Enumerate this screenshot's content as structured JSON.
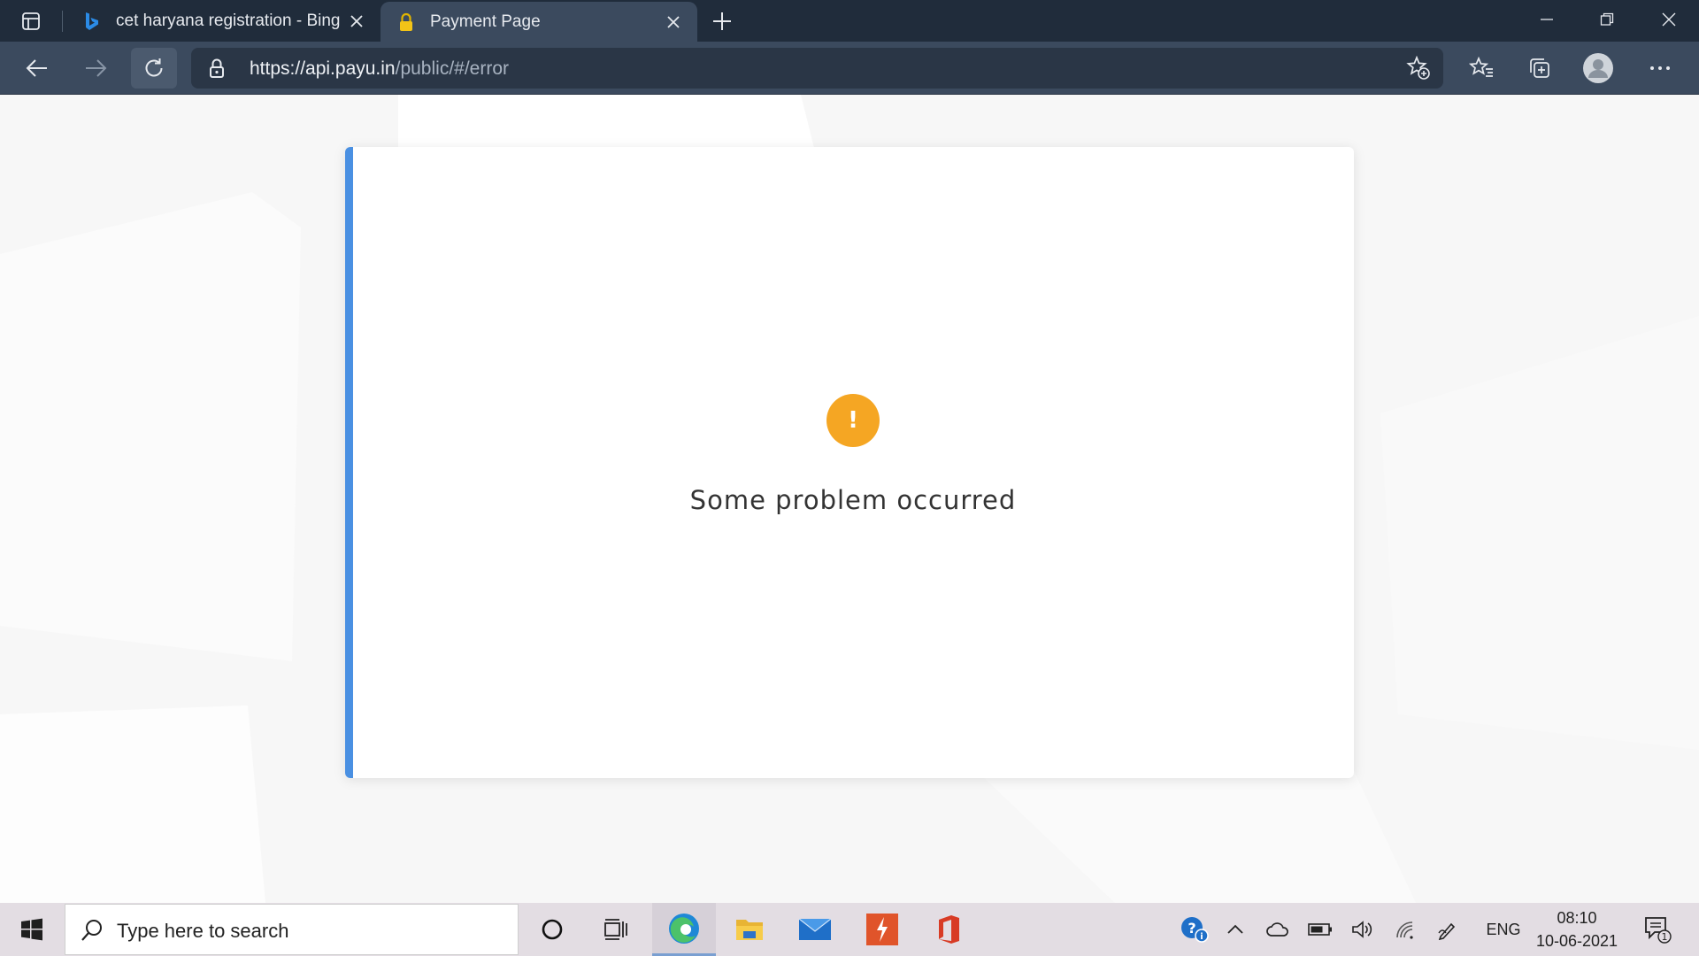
{
  "browser": {
    "tabs": [
      {
        "title": "cet haryana registration - Bing",
        "favicon": "bing-icon",
        "active": false
      },
      {
        "title": "Payment Page",
        "favicon": "lock-icon",
        "active": true
      }
    ],
    "url": {
      "scheme": "https://",
      "host": "api.payu.in",
      "path": "/public/#/error"
    }
  },
  "page": {
    "error_icon_glyph": "!",
    "error_message": "Some problem occurred",
    "accent_color": "#4a90e2",
    "warning_color": "#f5a623"
  },
  "taskbar": {
    "search_placeholder": "Type here to search",
    "apps": [
      "cortana-icon",
      "task-view-icon",
      "edge-icon",
      "file-explorer-icon",
      "mail-icon",
      "swiftkey-icon",
      "office-icon"
    ],
    "language": "ENG",
    "time": "08:10",
    "date": "10-06-2021",
    "notification_count": "1"
  }
}
